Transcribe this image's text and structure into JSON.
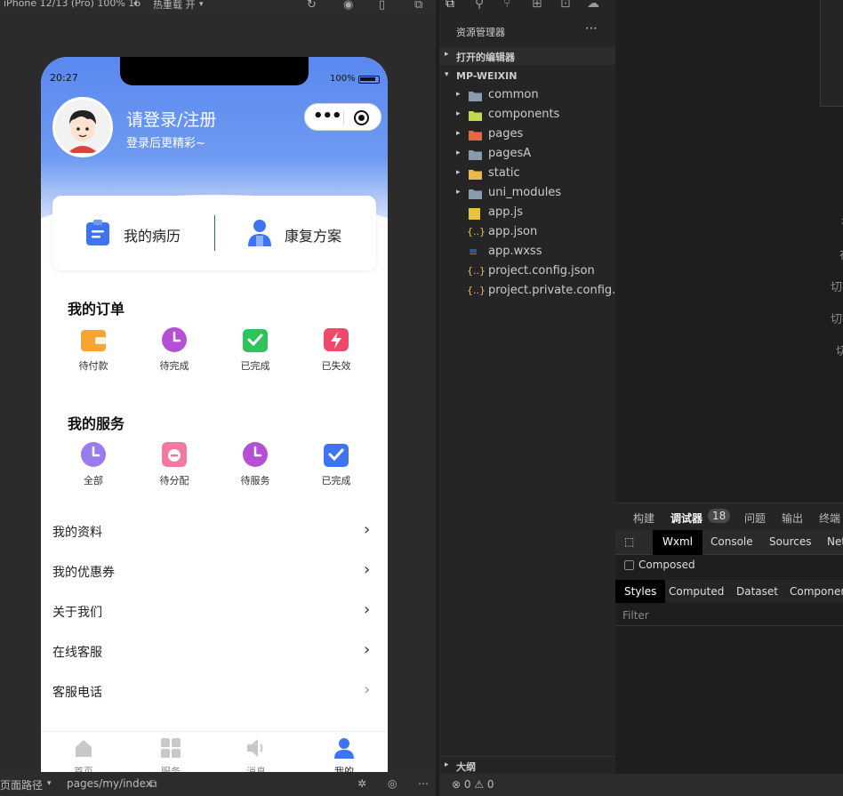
{
  "topbar": {
    "device": "iPhone 12/13 (Pro) 100% 16",
    "hot_reload": "热重载 开"
  },
  "phone": {
    "time": "20:27",
    "battery": "100%",
    "login_title": "请登录/注册",
    "login_sub": "登录后更精彩~",
    "card": {
      "left": "我的病历",
      "right": "康复方案"
    },
    "orders": {
      "title": "我的订单",
      "items": [
        {
          "label": "待付款",
          "icon": "wallet-icon",
          "color": "#f7a531"
        },
        {
          "label": "待完成",
          "icon": "clock-icon",
          "color": "#b54fd6"
        },
        {
          "label": "已完成",
          "icon": "check-icon",
          "color": "#2fc45b"
        },
        {
          "label": "已失效",
          "icon": "lightning-icon",
          "color": "#f2486b"
        }
      ]
    },
    "services": {
      "title": "我的服务",
      "items": [
        {
          "label": "全部",
          "icon": "clock-icon",
          "color": "#9b7bf0"
        },
        {
          "label": "待分配",
          "icon": "minus-icon",
          "color": "#f27aa0"
        },
        {
          "label": "待服务",
          "icon": "clock-icon",
          "color": "#b54fd6"
        },
        {
          "label": "已完成",
          "icon": "check-icon",
          "color": "#3d74f2"
        }
      ]
    },
    "menu": [
      "我的资料",
      "我的优惠券",
      "关于我们",
      "在线客服",
      "客服电话"
    ],
    "tabs": [
      "首页",
      "服务",
      "消息",
      "我的"
    ],
    "active_tab_color": "#3d74f2"
  },
  "sim_bottom": {
    "path_label": "页面路径",
    "path": "pages/my/index"
  },
  "explorer": {
    "title": "资源管理器",
    "open_editors": "打开的编辑器",
    "project": "MP-WEIXIN",
    "tree": [
      {
        "name": "common",
        "type": "folder",
        "color": "#8a9bb0"
      },
      {
        "name": "components",
        "type": "folder",
        "color": "#c5d84a"
      },
      {
        "name": "pages",
        "type": "folder",
        "color": "#e8664a"
      },
      {
        "name": "pagesA",
        "type": "folder",
        "color": "#8a9bb0"
      },
      {
        "name": "static",
        "type": "folder",
        "color": "#e8b84a"
      },
      {
        "name": "uni_modules",
        "type": "folder",
        "color": "#8a9bb0"
      },
      {
        "name": "app.js",
        "type": "js",
        "color": "#e8c43a"
      },
      {
        "name": "app.json",
        "type": "json",
        "color": "#e8c43a"
      },
      {
        "name": "app.wxss",
        "type": "css",
        "color": "#3d8bf2"
      },
      {
        "name": "project.config.json",
        "type": "json",
        "color": "#e8c43a"
      },
      {
        "name": "project.private.config.js...",
        "type": "json",
        "color": "#e8c43a"
      }
    ],
    "outline": "大纲",
    "status": "⊗ 0 ⚠ 0"
  },
  "editor": {
    "hints": [
      "在打开的文件之间切换",
      "在文件中查找",
      "切换终端",
      "切换面板",
      "切换侧边栏可见性"
    ]
  },
  "devtools": {
    "tabs": [
      "构建",
      "调试器",
      "18",
      "问题",
      "输出",
      "终端"
    ],
    "panels": [
      "Wxml",
      "Console",
      "Sources",
      "Net"
    ],
    "composed": "Composed",
    "style_tabs": [
      "Styles",
      "Computed",
      "Dataset",
      "Component"
    ],
    "filter": "Filter"
  }
}
